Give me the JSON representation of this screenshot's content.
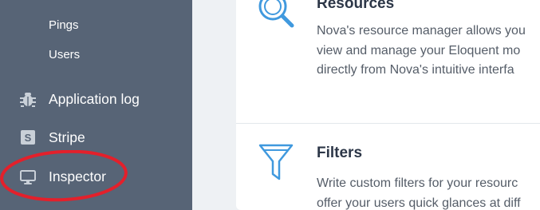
{
  "sidebar": {
    "sub_items": [
      "Pings",
      "Users"
    ],
    "items": [
      {
        "label": "Application log",
        "icon": "bug-icon"
      },
      {
        "label": "Stripe",
        "icon": "stripe-s-icon"
      },
      {
        "label": "Inspector",
        "icon": "monitor-icon"
      }
    ],
    "highlighted_item": "Inspector",
    "annotation_color": "#e3202b"
  },
  "resources": {
    "title": "Resources",
    "lines": [
      "Nova's resource manager allows you",
      "view and manage your Eloquent mo",
      "directly from Nova's intuitive interfa"
    ]
  },
  "filters": {
    "title": "Filters",
    "lines": [
      "Write custom filters for your resourc",
      "offer your users quick glances at diff"
    ]
  },
  "colors": {
    "sidebar_bg": "#576476",
    "accent": "#4099de",
    "card_bg": "#ffffff"
  }
}
